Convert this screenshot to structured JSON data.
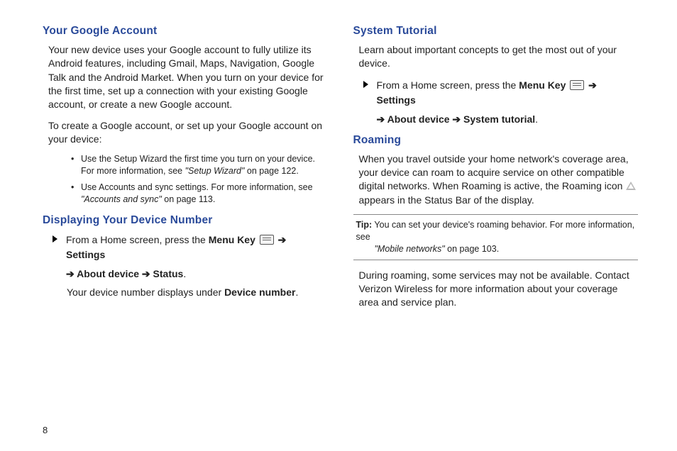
{
  "pageNumber": "8",
  "left": {
    "h1": "Your Google Account",
    "p1": "Your new device uses your Google account to fully utilize its Android features, including Gmail, Maps, Navigation, Google Talk and the Android Market. When you turn on your device for the first time, set up a connection with your existing Google account, or create a new Google account.",
    "p2": "To create a Google account, or set up your Google account on your device:",
    "bullets": {
      "b1a": "Use the Setup Wizard the first time you turn on your device. For more information, see ",
      "b1_ref": "\"Setup Wizard\"",
      "b1b": " on page 122.",
      "b2a": "Use Accounts and sync settings. For more information, see ",
      "b2_ref": "\"Accounts and sync\"",
      "b2b": " on page 113."
    },
    "h2": "Displaying Your Device Number",
    "step1": {
      "a": "From a Home screen, press the ",
      "menuKey": "Menu Key",
      "arrow1": " ➔ ",
      "settings": "Settings",
      "arrow2": "➔ ",
      "aboutDevice": "About device",
      "arrow3": " ➔ ",
      "status": "Status",
      "tail": "."
    },
    "after1a": "Your device number displays under ",
    "after1b": "Device number",
    "after1c": "."
  },
  "right": {
    "h1": "System Tutorial",
    "p1": "Learn about important concepts to get the most out of your device.",
    "step1": {
      "a": "From a Home screen, press the ",
      "menuKey": "Menu Key",
      "arrow1": " ➔ ",
      "settings": "Settings",
      "arrow2": "➔ ",
      "aboutDevice": "About device",
      "arrow3": " ➔ ",
      "tutorial": "System tutorial",
      "tail": "."
    },
    "h2": "Roaming",
    "p2a": "When you travel outside your home network's coverage area, your device can roam to acquire service on other compatible digital networks. When Roaming is active, the Roaming icon ",
    "p2b": " appears in the Status Bar of the display.",
    "tip": {
      "label": "Tip:",
      "a": " You can set your device's roaming behavior. For more information, see ",
      "ref": "\"Mobile networks\"",
      "b": " on page 103."
    },
    "p3": "During roaming, some services may not be available. Contact Verizon Wireless for more information about your coverage area and service plan."
  }
}
